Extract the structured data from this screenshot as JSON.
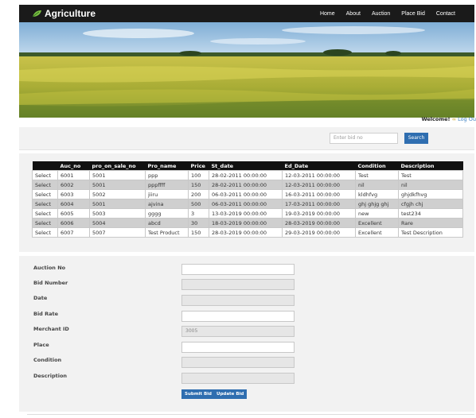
{
  "brand": {
    "name": "Agriculture"
  },
  "nav": {
    "items": [
      "Home",
      "About",
      "Auction",
      "Place Bid",
      "Contact"
    ]
  },
  "welcome": {
    "text": "Welcome!",
    "logout": "Log Ou"
  },
  "search": {
    "placeholder": "Enter bid no",
    "button": "Search"
  },
  "table": {
    "headers": [
      "",
      "Auc_no",
      "pro_on_sale_no",
      "Pro_name",
      "Price",
      "St_date",
      "Ed_Date",
      "Condition",
      "Description"
    ],
    "rows": [
      [
        "Select",
        "6001",
        "5001",
        "ppp",
        "100",
        "28-02-2011 00:00:00",
        "12-03-2011 00:00:00",
        "Test",
        "Test"
      ],
      [
        "Select",
        "6002",
        "5001",
        "pppffff",
        "150",
        "28-02-2011 00:00:00",
        "12-03-2011 00:00:00",
        "nil",
        "nil"
      ],
      [
        "Select",
        "6003",
        "5002",
        "jiiru",
        "200",
        "06-03-2011 00:00:00",
        "16-03-2011 00:00:00",
        "kldhfvg",
        "ghjdkfhvg"
      ],
      [
        "Select",
        "6004",
        "5001",
        "ajvina",
        "500",
        "06-03-2011 00:00:00",
        "17-03-2011 00:00:00",
        "ghj ghjg ghj",
        "cfgjh chj"
      ],
      [
        "Select",
        "6005",
        "5003",
        "gggg",
        "3",
        "13-03-2019 00:00:00",
        "19-03-2019 00:00:00",
        "new",
        "test234"
      ],
      [
        "Select",
        "6006",
        "5004",
        "abcd",
        "30",
        "18-03-2019 00:00:00",
        "28-03-2019 00:00:00",
        "Excellent",
        "Rare"
      ],
      [
        "Select",
        "6007",
        "5007",
        "Test Product",
        "150",
        "28-03-2019 00:00:00",
        "29-03-2019 00:00:00",
        "Excellent",
        "Test Description"
      ]
    ]
  },
  "form": {
    "fields": [
      {
        "label": "Auction No",
        "value": "",
        "disabled": false
      },
      {
        "label": "Bid Number",
        "value": "",
        "disabled": true
      },
      {
        "label": "Date",
        "value": "",
        "disabled": true
      },
      {
        "label": "Bid Rate",
        "value": "",
        "disabled": false
      },
      {
        "label": "Merchant ID",
        "value": "3005",
        "disabled": true
      },
      {
        "label": "Place",
        "value": "",
        "disabled": false
      },
      {
        "label": "Condition",
        "value": "",
        "disabled": true
      },
      {
        "label": "Description",
        "value": "",
        "disabled": true
      }
    ],
    "submit": "Submit Bid",
    "update": "Update Bid"
  },
  "colors": {
    "navbar": "#1a1a1a",
    "accent": "#2f6eb0",
    "panel": "#f2f2f2",
    "field_bg": "#7aa84a",
    "sky": "#8fb8dc"
  }
}
